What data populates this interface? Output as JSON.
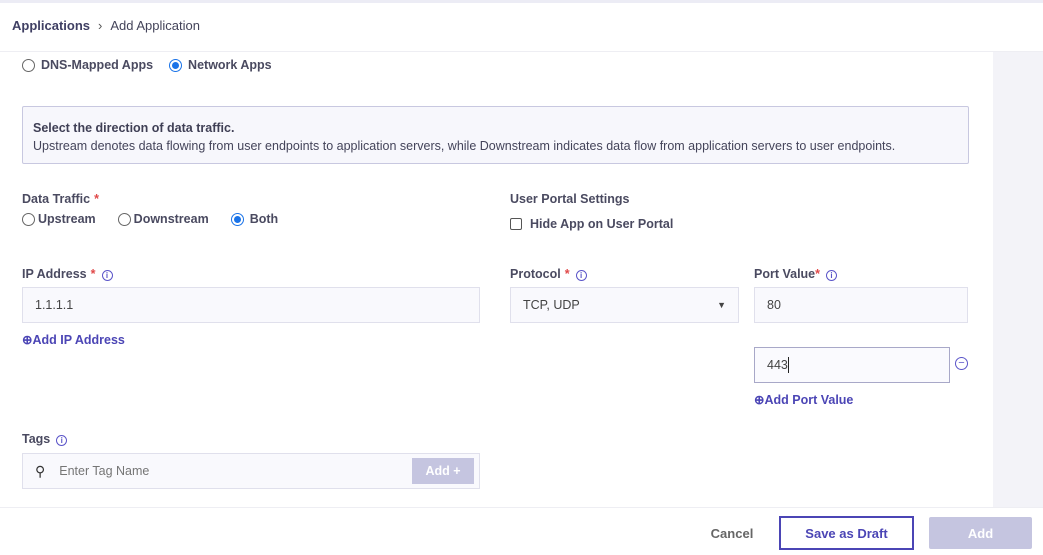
{
  "breadcrumb": {
    "root": "Applications",
    "current": "Add Application"
  },
  "app_type": {
    "options": [
      "DNS-Mapped Apps",
      "Network Apps"
    ],
    "selected": "Network Apps"
  },
  "info_box": {
    "title": "Select the direction of data traffic.",
    "text": "Upstream denotes data flowing from user endpoints to application servers, while Downstream indicates data flow from application servers to user endpoints."
  },
  "data_traffic": {
    "label": "Data Traffic",
    "required": "*",
    "options": [
      "Upstream",
      "Downstream",
      "Both"
    ],
    "selected": "Both"
  },
  "user_portal": {
    "label": "User Portal Settings",
    "checkbox_label": "Hide App on User Portal",
    "checked": false
  },
  "ip_address": {
    "label": "IP Address",
    "required": "*",
    "value": "1.1.1.1",
    "add_link": "Add IP Address"
  },
  "protocol": {
    "label": "Protocol",
    "required": "*",
    "value": "TCP, UDP"
  },
  "port_value": {
    "label": "Port Value",
    "required": "*",
    "values": [
      "80",
      "443"
    ],
    "add_link": "Add Port Value"
  },
  "tags": {
    "label": "Tags",
    "placeholder": "Enter Tag Name",
    "add_button": "Add +"
  },
  "footer": {
    "cancel": "Cancel",
    "save_draft": "Save as Draft",
    "add": "Add"
  },
  "colors": {
    "accent": "#4b45b5",
    "radio": "#1a73e8",
    "required": "#e04848",
    "disabled_button": "#c5c5e0"
  }
}
